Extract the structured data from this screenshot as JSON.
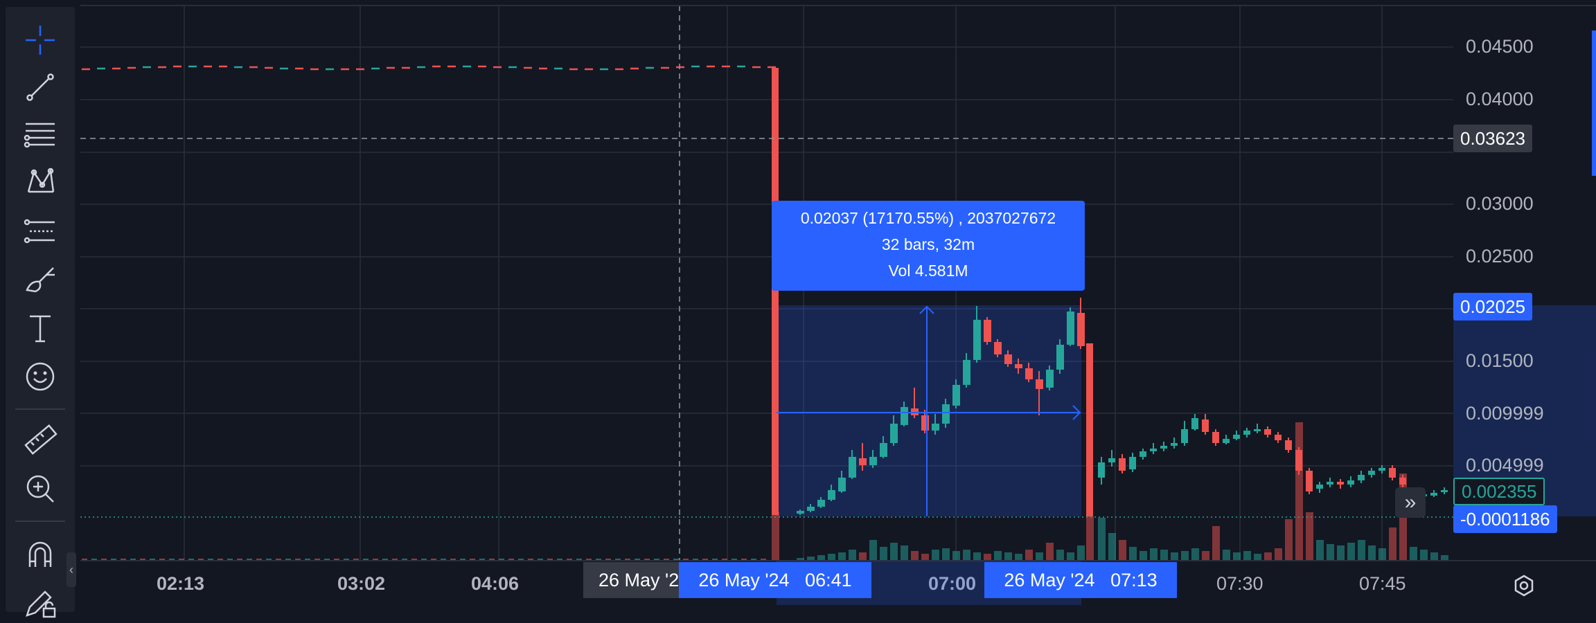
{
  "toolbar": {
    "tools": [
      {
        "name": "crosshair-icon"
      },
      {
        "name": "trend-line-icon"
      },
      {
        "name": "horizontal-lines-icon"
      },
      {
        "name": "pattern-icon"
      },
      {
        "name": "fib-retracement-icon"
      },
      {
        "name": "brush-icon"
      },
      {
        "name": "text-icon"
      },
      {
        "name": "emoji-icon"
      },
      {
        "name": "ruler-icon"
      },
      {
        "name": "zoom-in-icon"
      },
      {
        "name": "magnet-icon"
      },
      {
        "name": "pencil-lock-icon"
      }
    ],
    "collapse_glyph": "‹"
  },
  "price_axis": {
    "labels": [
      "0.04500",
      "0.04000",
      "0.03000",
      "0.02500",
      "0.01500",
      "0.009999",
      "0.004999"
    ],
    "crosshair_price": "0.03623",
    "measure_top_price": "0.02025",
    "last_price": "0.002355",
    "measure_bottom_price": "-0.0001186"
  },
  "time_axis": {
    "labels": [
      "02:13",
      "03:02",
      "04:06",
      "07:00",
      "07:30",
      "07:45"
    ],
    "crosshair_time": "26 May '2",
    "measure_start": "26 May '24   06:41",
    "measure_end": "26 May '24   07:13",
    "settings_icon": "gear-icon"
  },
  "measure_tooltip": {
    "line1": "0.02037 (17170.55%) , 2037027672",
    "line2": "32 bars, 32m",
    "line3": "Vol 4.581M"
  },
  "scroll_button": "»",
  "colors": {
    "background": "#131722",
    "up": "#26a69a",
    "down": "#ef5350",
    "accent": "#2962ff"
  }
}
